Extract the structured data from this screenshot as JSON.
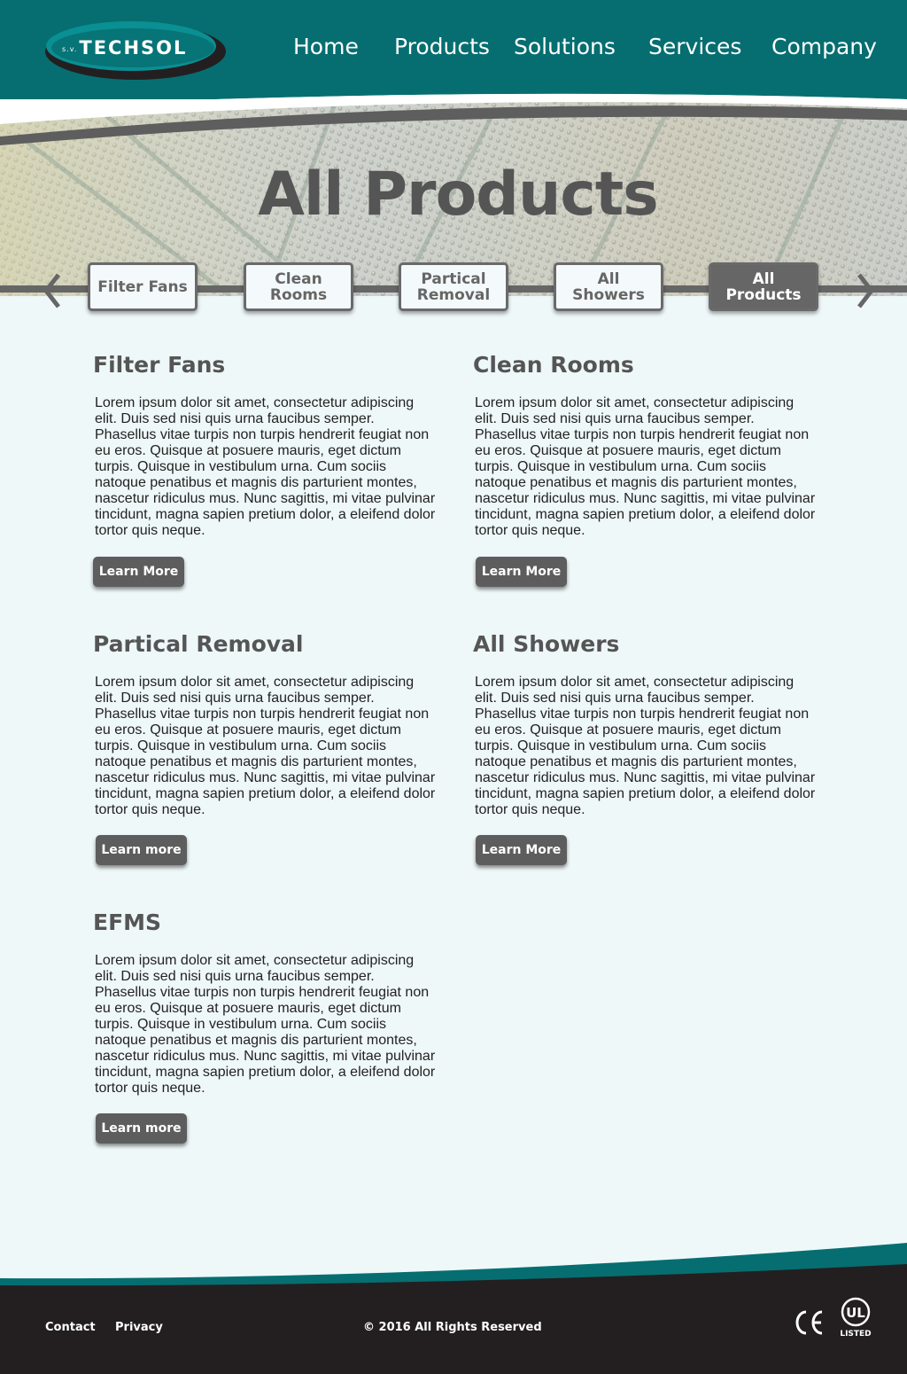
{
  "brand": {
    "prefix": "s.v.",
    "name": "TECHSOL"
  },
  "nav": {
    "home": "Home",
    "products": "Products",
    "solutions": "Solutions",
    "services": "Services",
    "company": "Company"
  },
  "hero": {
    "title": "All Products"
  },
  "tabs": {
    "filter_fans": "Filter Fans",
    "clean_rooms": "Clean Rooms",
    "partical_removal": "Partical Removal",
    "all_showers": "All Showers",
    "all_products": "All Products"
  },
  "sections": [
    {
      "title": "Filter Fans",
      "body": "Lorem ipsum dolor sit amet, consectetur adipiscing elit. Duis sed nisi quis urna faucibus semper. Phasellus vitae turpis non turpis hendrerit feugiat non eu eros. Quisque at posuere mauris, eget dictum turpis. Quisque in vestibulum urna. Cum sociis natoque penatibus et magnis dis parturient montes, nascetur ridiculus mus. Nunc sagittis, mi vitae pulvinar tincidunt, magna sapien pretium dolor, a eleifend dolor tortor quis neque.",
      "button": "Learn More"
    },
    {
      "title": "Clean Rooms",
      "body": "Lorem ipsum dolor sit amet, consectetur adipiscing elit. Duis sed nisi quis urna faucibus semper. Phasellus vitae turpis non turpis hendrerit feugiat non eu eros. Quisque at posuere mauris, eget dictum turpis. Quisque in vestibulum urna. Cum sociis natoque penatibus et magnis dis parturient montes, nascetur ridiculus mus. Nunc sagittis, mi vitae pulvinar tincidunt, magna sapien pretium dolor, a eleifend dolor tortor quis neque.",
      "button": "Learn More"
    },
    {
      "title": "Partical Removal",
      "body": "Lorem ipsum dolor sit amet, consectetur adipiscing elit. Duis sed nisi quis urna faucibus semper. Phasellus vitae turpis non turpis hendrerit feugiat non eu eros. Quisque at posuere mauris, eget dictum turpis. Quisque in vestibulum urna. Cum sociis natoque penatibus et magnis dis parturient montes, nascetur ridiculus mus. Nunc sagittis, mi vitae pulvinar tincidunt, magna sapien pretium dolor, a eleifend dolor tortor quis neque.",
      "button": "Learn more"
    },
    {
      "title": "All Showers",
      "body": "Lorem ipsum dolor sit amet, consectetur adipiscing elit. Duis sed nisi quis urna faucibus semper. Phasellus vitae turpis non turpis hendrerit feugiat non eu eros. Quisque at posuere mauris, eget dictum turpis. Quisque in vestibulum urna. Cum sociis natoque penatibus et magnis dis parturient montes, nascetur ridiculus mus. Nunc sagittis, mi vitae pulvinar tincidunt, magna sapien pretium dolor, a eleifend dolor tortor quis neque.",
      "button": "Learn More"
    },
    {
      "title": "EFMS",
      "body": "Lorem ipsum dolor sit amet, consectetur adipiscing elit. Duis sed nisi quis urna faucibus semper. Phasellus vitae turpis non turpis hendrerit feugiat non eu eros. Quisque at posuere mauris, eget dictum turpis. Quisque in vestibulum urna. Cum sociis natoque penatibus et magnis dis parturient montes, nascetur ridiculus mus. Nunc sagittis, mi vitae pulvinar tincidunt, magna sapien pretium dolor, a eleifend dolor tortor quis neque.",
      "button": "Learn more"
    }
  ],
  "footer": {
    "contact": "Contact",
    "privacy": "Privacy",
    "copyright": "© 2016 All Rights Reserved",
    "ce_mark": "CE",
    "ul_mark": "UL",
    "ul_listed": "LISTED"
  },
  "colors": {
    "teal": "#066e70",
    "dark": "#231f20",
    "gray": "#5d5d5d",
    "background": "#eff8f9"
  }
}
